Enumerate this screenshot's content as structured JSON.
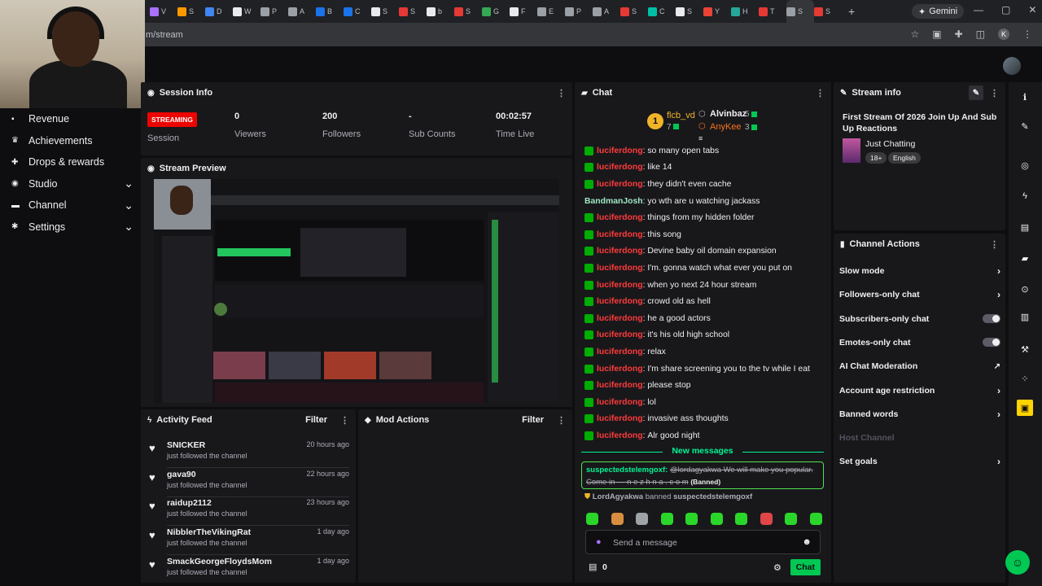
{
  "browser": {
    "tabs": [
      {
        "label": "V",
        "color": "#a970ff"
      },
      {
        "label": "S",
        "color": "#ff9800"
      },
      {
        "label": "D",
        "color": "#4285f4"
      },
      {
        "label": "W",
        "color": "#e8eaed"
      },
      {
        "label": "P",
        "color": "#9aa0a6"
      },
      {
        "label": "A",
        "color": "#9aa0a6"
      },
      {
        "label": "B",
        "color": "#1a73e8"
      },
      {
        "label": "C",
        "color": "#1a73e8"
      },
      {
        "label": "S",
        "color": "#e8eaed"
      },
      {
        "label": "S",
        "color": "#e53935"
      },
      {
        "label": "b",
        "color": "#e8eaed"
      },
      {
        "label": "S",
        "color": "#e53935"
      },
      {
        "label": "G",
        "color": "#34a853"
      },
      {
        "label": "F",
        "color": "#e8eaed"
      },
      {
        "label": "E",
        "color": "#9aa0a6"
      },
      {
        "label": "P",
        "color": "#9aa0a6"
      },
      {
        "label": "A",
        "color": "#9aa0a6"
      },
      {
        "label": "S",
        "color": "#e53935"
      },
      {
        "label": "C",
        "color": "#00bfa5"
      },
      {
        "label": "S",
        "color": "#e8eaed"
      },
      {
        "label": "Y",
        "color": "#ea4335"
      },
      {
        "label": "H",
        "color": "#26a69a"
      },
      {
        "label": "T",
        "color": "#e53935"
      },
      {
        "label": "S",
        "color": "#9aa0a6"
      },
      {
        "label": "S",
        "color": "#e53935"
      }
    ],
    "gemini_label": "Gemini",
    "url": "m/stream",
    "profile_initial": "K"
  },
  "sidebar": {
    "items": [
      {
        "label": "Revenue",
        "icon": "revenue-icon",
        "glyph": "▪",
        "chevron": false
      },
      {
        "label": "Achievements",
        "icon": "trophy-icon",
        "glyph": "♛",
        "chevron": false
      },
      {
        "label": "Drops & rewards",
        "icon": "gift-icon",
        "glyph": "✚",
        "chevron": false
      },
      {
        "label": "Studio",
        "icon": "studio-icon",
        "glyph": "◉",
        "chevron": true
      },
      {
        "label": "Channel",
        "icon": "channel-icon",
        "glyph": "▬",
        "chevron": true
      },
      {
        "label": "Settings",
        "icon": "gear-icon",
        "glyph": "✱",
        "chevron": true
      }
    ]
  },
  "session": {
    "title": "Session Info",
    "status": "STREAMING",
    "status_label": "Session",
    "viewers_value": "0",
    "viewers_label": "Viewers",
    "followers_value": "200",
    "followers_label": "Followers",
    "subs_value": "-",
    "subs_label": "Sub Counts",
    "time_value": "00:02:57",
    "time_label": "Time Live"
  },
  "preview": {
    "title": "Stream Preview"
  },
  "activity": {
    "title": "Activity Feed",
    "filter": "Filter",
    "items": [
      {
        "name": "SNICKER",
        "sub": "just followed the channel",
        "time": "20 hours ago"
      },
      {
        "name": "gava90",
        "sub": "just followed the channel",
        "time": "22 hours ago"
      },
      {
        "name": "raidup2112",
        "sub": "just followed the channel",
        "time": "23 hours ago"
      },
      {
        "name": "NibblerTheVikingRat",
        "sub": "just followed the channel",
        "time": "1 day ago"
      },
      {
        "name": "SmackGeorgeFloydsMom",
        "sub": "just followed the channel",
        "time": "1 day ago"
      }
    ]
  },
  "mod": {
    "title": "Mod Actions",
    "filter": "Filter"
  },
  "chat": {
    "title": "Chat",
    "leader1": {
      "rank": "1",
      "name": "flcb_vd",
      "count": "7"
    },
    "leader2": {
      "name": "Alvinbaz",
      "count": "5"
    },
    "leader3": {
      "name": "AnyKee",
      "count": "3"
    },
    "messages": [
      {
        "user": "luciferdong",
        "text": "so many open tabs",
        "badge": true
      },
      {
        "user": "luciferdong",
        "text": "like 14",
        "badge": true
      },
      {
        "user": "luciferdong",
        "text": "they didn't even cache",
        "badge": true
      },
      {
        "user": "BandmanJosh",
        "text": "yo wth are u watching jackass",
        "badge": false
      },
      {
        "user": "luciferdong",
        "text": "things from my hidden folder",
        "badge": true
      },
      {
        "user": "luciferdong",
        "text": "this song",
        "badge": true
      },
      {
        "user": "luciferdong",
        "text": "Devine baby oil domain expansion",
        "badge": true
      },
      {
        "user": "luciferdong",
        "text": "I'm. gonna watch what ever you put on",
        "badge": true
      },
      {
        "user": "luciferdong",
        "text": "when yo next 24 hour stream",
        "badge": true
      },
      {
        "user": "luciferdong",
        "text": "crowd old as hell",
        "badge": true
      },
      {
        "user": "luciferdong",
        "text": "he a good actors",
        "badge": true
      },
      {
        "user": "luciferdong",
        "text": "it's his old high school",
        "badge": true
      },
      {
        "user": "luciferdong",
        "text": "relax",
        "badge": true
      },
      {
        "user": "luciferdong",
        "text": "I'm share screening you to the tv while I eat",
        "badge": true
      },
      {
        "user": "luciferdong",
        "text": "please stop",
        "badge": true
      },
      {
        "user": "luciferdong",
        "text": "lol",
        "badge": true
      },
      {
        "user": "luciferdong",
        "text": "invasive ass thoughts",
        "badge": true
      },
      {
        "user": "luciferdong",
        "text": "Alr good night",
        "badge": true
      }
    ],
    "new_messages": "New messages",
    "banned_user": "suspectedstelemgoxf:",
    "banned_text": "@lordagyakwa We will make you popular. Come in — n e z h n a . c o m",
    "banned_tag": "(Banned)",
    "ban_notice_mod": "LordAgyakwa",
    "ban_notice_mid": "banned",
    "ban_notice_target": "suspectedstelemgoxf",
    "emotes": [
      "#2bd62b",
      "#d98e3f",
      "#9ea3a8",
      "#2bd62b",
      "#2bd62b",
      "#2bd62b",
      "#2bd62b",
      "#e04646",
      "#2bd62b",
      "#2bd62b"
    ],
    "placeholder": "Send a message",
    "points": "0",
    "chat_button": "Chat"
  },
  "streaminfo": {
    "title": "Stream info",
    "stream_title": "First Stream Of 2026 Join Up And Sub Up Reactions",
    "category": "Just Chatting",
    "tags": [
      "18+",
      "English"
    ]
  },
  "channel_actions": {
    "title": "Channel Actions",
    "rows": [
      {
        "label": "Slow mode",
        "control": "chevron"
      },
      {
        "label": "Followers-only chat",
        "control": "chevron"
      },
      {
        "label": "Subscribers-only chat",
        "control": "toggle"
      },
      {
        "label": "Emotes-only chat",
        "control": "toggle"
      },
      {
        "label": "AI Chat Moderation",
        "control": "external"
      },
      {
        "label": "Account age restriction",
        "control": "chevron"
      },
      {
        "label": "Banned words",
        "control": "chevron"
      },
      {
        "label": "Host Channel",
        "control": "none"
      },
      {
        "label": "Set goals",
        "control": "chevron"
      }
    ]
  },
  "rail": {
    "icons": [
      "info-icon",
      "pencil-icon",
      "target-icon",
      "bolt-icon",
      "clipboard-icon",
      "chat-bubble-icon",
      "broadcast-icon",
      "layout-icon",
      "wrench-icon",
      "dots-icon",
      "clapper-icon"
    ]
  }
}
